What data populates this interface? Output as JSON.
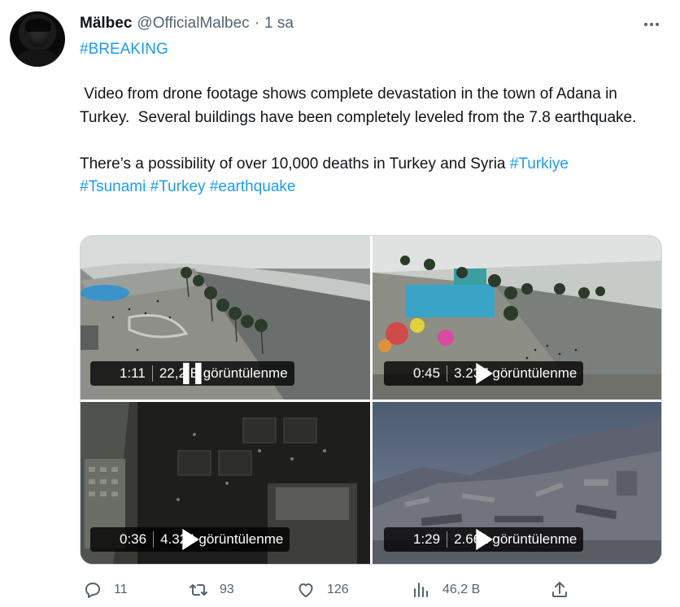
{
  "author": {
    "name": "Mälbec",
    "handle": "@OfficialMalbec",
    "separator": "·",
    "time": "1 sa"
  },
  "tweet": {
    "hashtag_line": "#BREAKING",
    "paragraph1": " Video from drone footage shows complete devastation in the town of Adana in Turkey.  Several buildings have been completely leveled from the 7.8 earthquake.",
    "paragraph2_text": "There’s a possibility of over 10,000 deaths in Turkey and Syria ",
    "tags": [
      "#Turkiye",
      "#Tsunami",
      "#Turkey",
      "#earthquake"
    ]
  },
  "media": [
    {
      "state": "pause",
      "duration": "1:11",
      "views": "22,2 B görüntülenme"
    },
    {
      "state": "play",
      "duration": "0:45",
      "views": "3.237 görüntülenme"
    },
    {
      "state": "play",
      "duration": "0:36",
      "views": "4.324 görüntülenme"
    },
    {
      "state": "play",
      "duration": "1:29",
      "views": "2.661 görüntülenme"
    }
  ],
  "actions": {
    "replies": "11",
    "retweets": "93",
    "likes": "126",
    "views": "46,2 B"
  },
  "icons": {
    "reply": "reply-icon",
    "retweet": "retweet-icon",
    "like": "heart-icon",
    "views": "analytics-icon",
    "share": "share-icon",
    "more": "more-icon"
  },
  "colors": {
    "accent": "#1d9bf0",
    "text": "#0f1419",
    "secondary": "#536471",
    "border": "#cfd9de"
  }
}
